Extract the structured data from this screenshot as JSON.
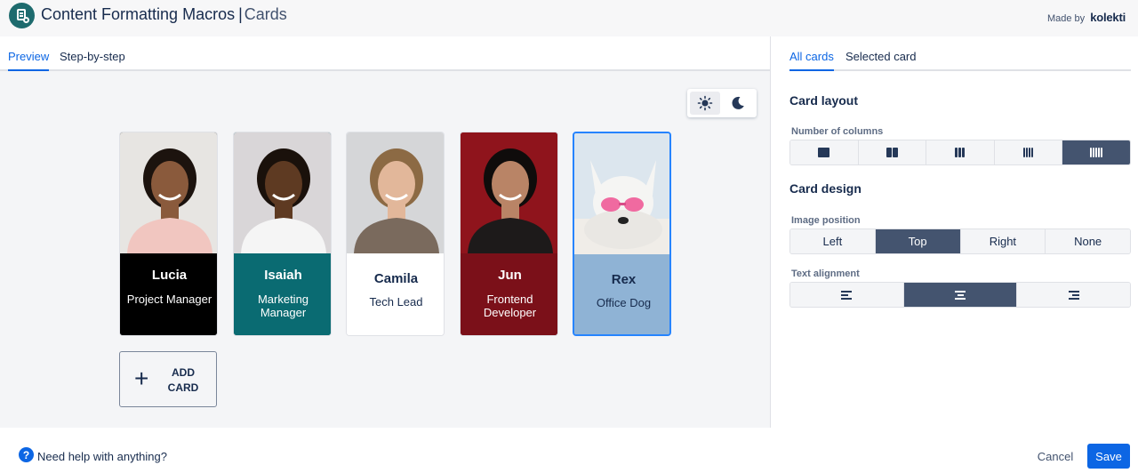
{
  "header": {
    "title": "Content Formatting Macros",
    "separator": "|",
    "subtitle": "Cards",
    "made_by_prefix": "Made by",
    "brand": "kolekti"
  },
  "left_tabs": [
    {
      "label": "Preview",
      "active": true
    },
    {
      "label": "Step-by-step",
      "active": false
    }
  ],
  "theme_toggle": {
    "options": [
      "sun-icon",
      "moon-icon"
    ],
    "selected": "light"
  },
  "cards": [
    {
      "name": "Lucia",
      "role": "Project Manager",
      "bg": "#000000",
      "text_color": "#ffffff",
      "photo_bg": "#e7e5e2",
      "skin": "#8a5a3c",
      "hair": "#1c130e",
      "shirt": "#f1c6c0",
      "selected": false
    },
    {
      "name": "Isaiah",
      "role": "Marketing Manager",
      "bg": "#0a6b72",
      "text_color": "#ffffff",
      "photo_bg": "#d9d6d8",
      "skin": "#5e3a22",
      "hair": "#1a110b",
      "shirt": "#f5f5f5",
      "selected": false
    },
    {
      "name": "Camila",
      "role": "Tech Lead",
      "bg": "#ffffff",
      "text_color": "#172b4d",
      "photo_bg": "#d5d6d8",
      "skin": "#e2b79a",
      "hair": "#8c6a44",
      "shirt": "#7a6a5d",
      "selected": false
    },
    {
      "name": "Jun",
      "role": "Frontend Developer",
      "bg": "#7b1019",
      "text_color": "#ffffff",
      "photo_bg": "#8f141c",
      "skin": "#b98466",
      "hair": "#0f0c0b",
      "shirt": "#1d1a1a",
      "selected": false
    },
    {
      "name": "Rex",
      "role": "Office Dog",
      "bg": "#8fb3d5",
      "text_color": "#172b4d",
      "photo_bg": "#dce6ee",
      "skin": "#f5f5f3",
      "hair": "#e9e7e3",
      "shirt": "#f2f0ec",
      "selected": true
    }
  ],
  "add_card": {
    "label": "ADD CARD"
  },
  "right_tabs": [
    {
      "label": "All cards",
      "active": true
    },
    {
      "label": "Selected card",
      "active": false
    }
  ],
  "card_layout": {
    "title": "Card layout",
    "columns_label": "Number of columns",
    "column_options": [
      1,
      2,
      3,
      4,
      5
    ],
    "selected_columns": 5
  },
  "card_design": {
    "title": "Card design",
    "image_position_label": "Image position",
    "image_positions": [
      "Left",
      "Top",
      "Right",
      "None"
    ],
    "selected_image_position": "Top",
    "text_alignment_label": "Text alignment",
    "text_alignments": [
      "align-left-icon",
      "align-center-icon",
      "align-right-icon"
    ],
    "selected_text_alignment": "align-center-icon"
  },
  "footer": {
    "help_text": "Need help with anything?",
    "cancel_label": "Cancel",
    "save_label": "Save"
  },
  "colors": {
    "accent": "#0c66e4",
    "selected_segment": "#44546f",
    "app_logo": "#1e6b6e"
  }
}
